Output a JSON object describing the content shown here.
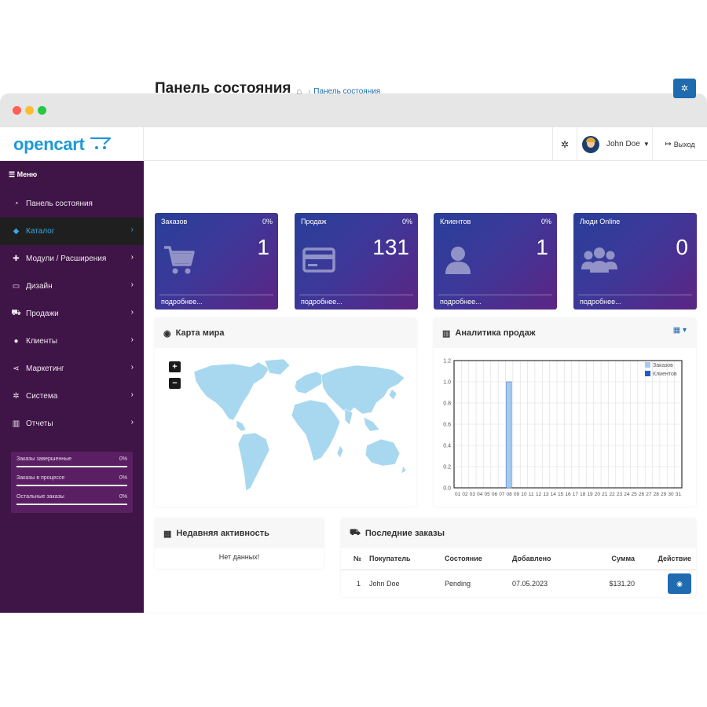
{
  "header": {
    "logo": "opencart",
    "user_name": "John Doe",
    "logout_label": "Выход"
  },
  "sidebar": {
    "menu_label": "Меню",
    "items": [
      {
        "label": "Панель состояния",
        "icon": "dashboard-icon"
      },
      {
        "label": "Каталог",
        "icon": "tag-icon",
        "active": true
      },
      {
        "label": "Модули / Расширения",
        "icon": "puzzle-icon"
      },
      {
        "label": "Дизайн",
        "icon": "monitor-icon"
      },
      {
        "label": "Продажи",
        "icon": "cart-icon"
      },
      {
        "label": "Клиенты",
        "icon": "user-icon"
      },
      {
        "label": "Маркетинг",
        "icon": "share-icon"
      },
      {
        "label": "Система",
        "icon": "gear-icon"
      },
      {
        "label": "Отчеты",
        "icon": "bar-chart-icon"
      }
    ],
    "stats": [
      {
        "label": "Заказы завершенные",
        "value": "0%"
      },
      {
        "label": "Заказы в процессе",
        "value": "0%"
      },
      {
        "label": "Остальные заказы",
        "value": "0%"
      }
    ]
  },
  "page": {
    "title": "Панель состояния",
    "breadcrumb": "Панель состояния"
  },
  "tiles": [
    {
      "label": "Заказов",
      "pct": "0%",
      "value": "1",
      "more": "подробнее..."
    },
    {
      "label": "Продаж",
      "pct": "0%",
      "value": "131",
      "more": "подробнее..."
    },
    {
      "label": "Клиентов",
      "pct": "0%",
      "value": "1",
      "more": "подробнее..."
    },
    {
      "label": "Люди Online",
      "pct": "",
      "value": "0",
      "more": "подробнее..."
    }
  ],
  "map_panel": {
    "title": "Карта мира",
    "zoom_in": "+",
    "zoom_out": "−"
  },
  "analytics_panel": {
    "title": "Аналитика продаж"
  },
  "chart_data": {
    "type": "bar",
    "categories": [
      "01",
      "02",
      "03",
      "04",
      "05",
      "06",
      "07",
      "08",
      "09",
      "10",
      "11",
      "12",
      "13",
      "14",
      "15",
      "16",
      "17",
      "18",
      "19",
      "20",
      "21",
      "22",
      "23",
      "24",
      "25",
      "26",
      "27",
      "28",
      "29",
      "30",
      "31"
    ],
    "series": [
      {
        "name": "Заказов",
        "color": "#a6cbef",
        "values": [
          0,
          0,
          0,
          0,
          0,
          0,
          0,
          1,
          0,
          0,
          0,
          0,
          0,
          0,
          0,
          0,
          0,
          0,
          0,
          0,
          0,
          0,
          0,
          0,
          0,
          0,
          0,
          0,
          0,
          0,
          0
        ]
      },
      {
        "name": "Клиентов",
        "color": "#1f5ec4",
        "values": [
          0,
          0,
          0,
          0,
          0,
          0,
          0,
          0,
          0,
          0,
          0,
          0,
          0,
          0,
          0,
          0,
          0,
          0,
          0,
          0,
          0,
          0,
          0,
          0,
          0,
          0,
          0,
          0,
          0,
          0,
          0
        ]
      }
    ],
    "yticks": [
      "0.0",
      "0.2",
      "0.4",
      "0.6",
      "0.8",
      "1.0",
      "1.2"
    ],
    "ylim": [
      0,
      1.2
    ],
    "grid": true,
    "legend": "top-right"
  },
  "activity_panel": {
    "title": "Недавняя активность",
    "empty": "Нет данных!"
  },
  "orders_panel": {
    "title": "Последние заказы",
    "columns": [
      "№",
      "Покупатель",
      "Состояние",
      "Добавлено",
      "Сумма",
      "Действие"
    ],
    "rows": [
      {
        "id": "1",
        "customer": "John Doe",
        "status": "Pending",
        "date": "07.05.2023",
        "total": "$131.20"
      }
    ]
  }
}
